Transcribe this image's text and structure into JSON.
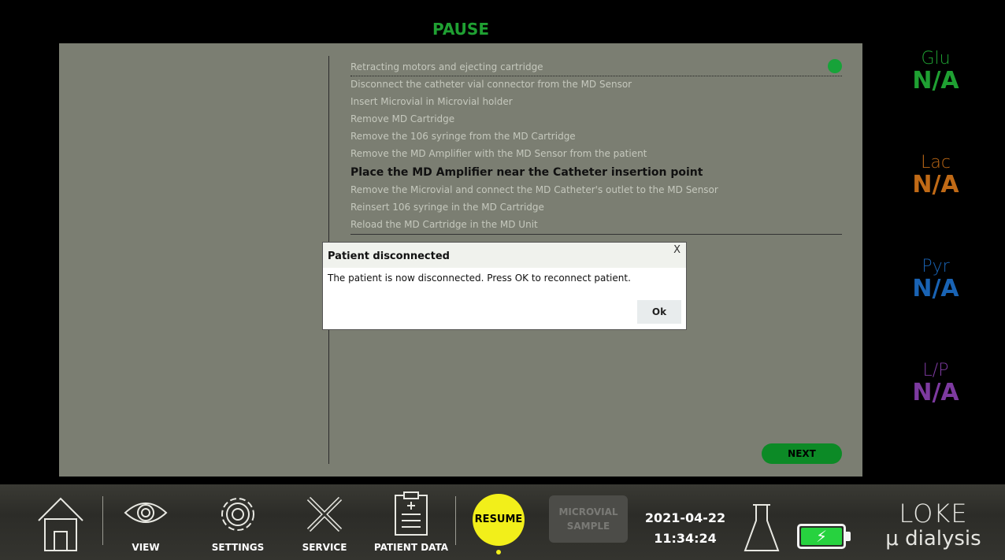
{
  "header": {
    "status": "PAUSE"
  },
  "steps": [
    "Retracting motors and ejecting cartridge",
    "Disconnect the catheter vial connector from the MD Sensor",
    "Insert Microvial in Microvial holder",
    "Remove MD Cartridge",
    "Remove the 106 syringe from the MD Cartridge",
    "Remove the MD Amplifier with the MD Sensor from the patient",
    "Place the MD Amplifier near the Catheter insertion point",
    "Remove the Microvial and connect the MD Catheter's outlet to the MD Sensor",
    "Reinsert 106 syringe in the MD Cartridge",
    "Reload the MD Cartridge in the MD Unit"
  ],
  "next_label": "NEXT",
  "metrics": [
    {
      "label": "Glu",
      "value": "N/A",
      "color": "#1fa032"
    },
    {
      "label": "Lac",
      "value": "N/A",
      "color": "#c06a16"
    },
    {
      "label": "Pyr",
      "value": "N/A",
      "color": "#1963b4"
    },
    {
      "label": "L/P",
      "value": "N/A",
      "color": "#7d3aa0"
    }
  ],
  "dialog": {
    "title": "Patient disconnected",
    "close": "X",
    "message": "The patient is now disconnected. Press OK to reconnect patient.",
    "ok_label": "Ok"
  },
  "toolbar": {
    "view_label": "VIEW",
    "settings_label": "SETTINGS",
    "service_label": "SERVICE",
    "patient_data_label": "PATIENT DATA",
    "resume_label": "RESUME",
    "microvial_label_line1": "MICROVIAL",
    "microvial_label_line2": "SAMPLE",
    "date": "2021-04-22",
    "time": "11:34:24",
    "battery_glyph": "⚡"
  },
  "brand": {
    "name": "LOKE",
    "sub": "μ dialysis"
  },
  "colors": {
    "accent_green": "#1fa032",
    "resume_yellow": "#f2ef1a",
    "battery_green": "#27d23f"
  }
}
